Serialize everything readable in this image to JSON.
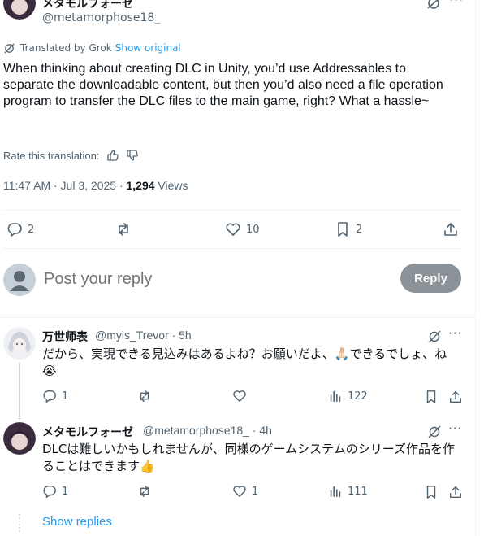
{
  "tweet": {
    "author_name": "メタモルフォーゼ",
    "author_handle": "@metamorphose18_",
    "translated_label": "Translated by Grok",
    "show_original": "Show original",
    "text": "When thinking about creating DLC in Unity, you’d use Addressables to separate the downloadable content, but then you’d also need a file operation program to transfer the DLC files to the main game, right? What a hassle~",
    "rate_label": "Rate this translation:",
    "time": "11:47 AM · Jul 3, 2025 · ",
    "views_count": "1,294",
    "views_label": " Views",
    "stats": {
      "replies": "2",
      "reposts": "",
      "likes": "10",
      "bookmarks": "2"
    }
  },
  "composer": {
    "placeholder": "Post your reply",
    "button": "Reply"
  },
  "replies": [
    {
      "name": "万世师表",
      "handle": "@myis_Trevor · 5h",
      "text": "だから、実現できる見込みはあるよね？お願いだよ、",
      "emoji1": "🙏🏻",
      "text2": "できるでしょ、ね",
      "emoji2": "😭",
      "replies": "1",
      "reposts": "",
      "likes": "",
      "views": "122"
    },
    {
      "name": "メタモルフォーゼ",
      "handle": "@metamorphose18_ · 4h",
      "text": "DLCは難しいかもしれませんが、同様のゲームシステムのシリーズ作品を作ることはできます",
      "emoji1": "👍",
      "replies": "1",
      "reposts": "",
      "likes": "1",
      "views": "111"
    }
  ],
  "show_replies": "Show replies"
}
